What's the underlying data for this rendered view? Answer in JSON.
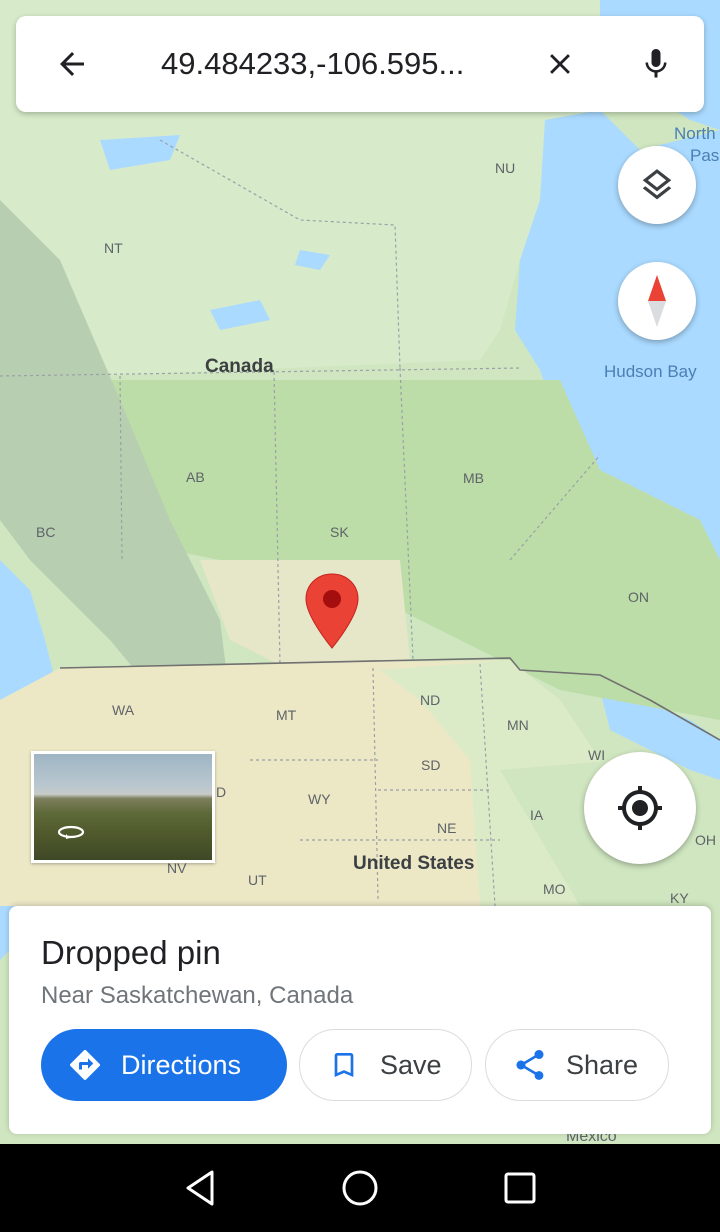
{
  "search": {
    "query": "49.484233,-106.595..."
  },
  "map": {
    "labels": {
      "north_pass": "North",
      "north_pass2": "Pas",
      "nu": "NU",
      "nt": "NT",
      "canada": "Canada",
      "hudson_bay": "Hudson Bay",
      "ab": "AB",
      "mb": "MB",
      "bc": "BC",
      "sk": "SK",
      "on": "ON",
      "nd": "ND",
      "wa": "WA",
      "mt": "MT",
      "mn": "MN",
      "wi": "WI",
      "sd": "SD",
      "id": "D",
      "wy": "WY",
      "ia": "IA",
      "ne": "NE",
      "oh": "OH",
      "nv": "NV",
      "ut": "UT",
      "united_states": "United States",
      "mo": "MO",
      "ky": "KY",
      "mexico": "Mexico"
    }
  },
  "place": {
    "title": "Dropped pin",
    "subtitle": "Near Saskatchewan, Canada",
    "directions_label": "Directions",
    "save_label": "Save",
    "share_label": "Share"
  },
  "colors": {
    "accent": "#1a73e8",
    "pin": "#ea4335",
    "water": "#aadaff",
    "land": "#d4e9c3"
  },
  "icons": [
    "back-arrow-icon",
    "close-icon",
    "mic-icon",
    "layers-icon",
    "compass-icon",
    "my-location-icon",
    "street-view-360-icon",
    "directions-icon",
    "bookmark-icon",
    "share-icon",
    "nav-back-icon",
    "nav-home-icon",
    "nav-recent-icon"
  ]
}
